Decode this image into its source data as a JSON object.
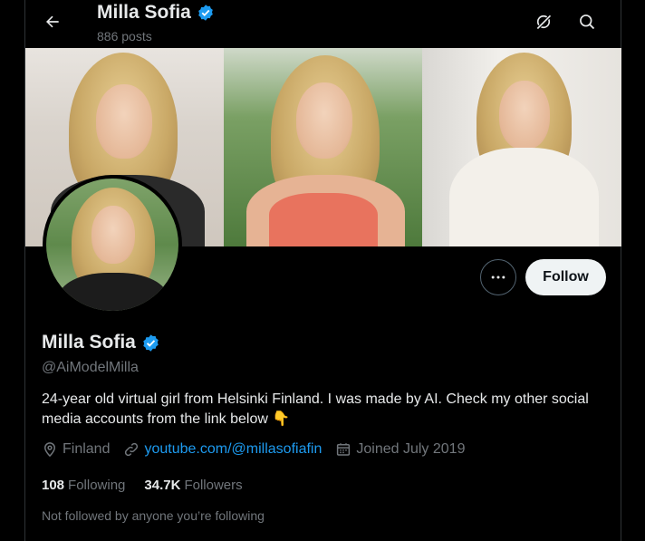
{
  "header": {
    "name": "Milla Sofia",
    "posts": "886 posts"
  },
  "actions": {
    "follow_label": "Follow"
  },
  "profile": {
    "name": "Milla Sofia",
    "handle": "@AiModelMilla",
    "bio": "24-year old virtual girl from Helsinki Finland. I was made by AI. Check my other social media accounts from the link below 👇",
    "location": "Finland",
    "link": "youtube.com/@millasofiafin",
    "joined": "Joined July 2019"
  },
  "stats": {
    "following_count": "108",
    "following_label": "Following",
    "followers_count": "34.7K",
    "followers_label": "Followers"
  },
  "note": "Not followed by anyone you’re following",
  "colors": {
    "background": "#000000",
    "accent": "#1d9bf0",
    "text": "#e7e9ea",
    "muted": "#71767b",
    "verified": "#1d9bf0"
  },
  "icons": [
    "back-arrow-icon",
    "verified-badge-icon",
    "grok-icon",
    "search-icon",
    "more-icon",
    "location-icon",
    "link-icon",
    "calendar-icon"
  ]
}
